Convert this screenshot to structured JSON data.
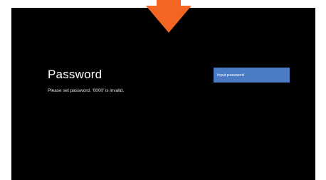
{
  "dialog": {
    "title": "Password",
    "description": "Please set password. '0000' is invalid."
  },
  "password_field": {
    "placeholder": "Input password",
    "value": ""
  },
  "colors": {
    "screen_background": "#000000",
    "page_background": "#ffffff",
    "input_background": "#4a7bc4",
    "pointer_arrow": "#f26522"
  },
  "icons": {
    "pointer": "down-arrow-icon"
  }
}
